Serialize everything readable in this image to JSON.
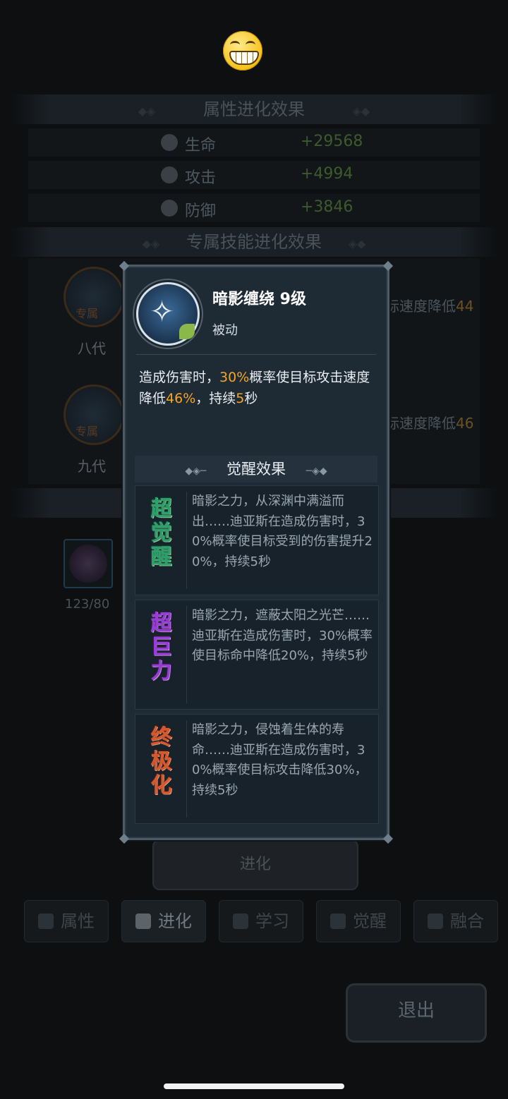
{
  "emoji": "grinning-face-icon",
  "attr_section": {
    "title": "属性进化效果",
    "stats": [
      {
        "label": "生命",
        "value": "+29568",
        "icon": "heart-icon"
      },
      {
        "label": "攻击",
        "value": "+4994",
        "icon": "attack-heart-icon"
      },
      {
        "label": "防御",
        "value": "+3846",
        "icon": "shield-icon"
      }
    ]
  },
  "skill_section": {
    "title": "专属技能进化效果",
    "rows": [
      {
        "tag": "专属",
        "gen": "八代",
        "text_prefix": "标速度降低",
        "value": "44"
      },
      {
        "tag": "专属",
        "gen": "九代",
        "text_prefix": "标速度降低",
        "value": "46"
      }
    ]
  },
  "item": {
    "count": "123/80"
  },
  "evolve_button": "进化",
  "tabs": [
    {
      "label": "属性",
      "icon": "paw-icon"
    },
    {
      "label": "进化",
      "icon": "evolve-arrow-icon"
    },
    {
      "label": "学习",
      "icon": "book-icon"
    },
    {
      "label": "觉醒",
      "icon": "awaken-wolf-icon"
    },
    {
      "label": "融合",
      "icon": "fusion-icon"
    }
  ],
  "exit_button": "退出",
  "popup": {
    "skill_name": "暗影缠绕 9级",
    "skill_type": "被动",
    "desc": {
      "p1": "造成伤害时，",
      "h1": "30%",
      "p2": "概率使目标攻击速度降低",
      "h2": "46%",
      "p3": "，持续",
      "h3": "5",
      "p4": "秒"
    },
    "awaken_title": "觉醒效果",
    "awakens": [
      {
        "badge": "超觉醒",
        "text": "暗影之力，从深渊中满溢而出……迪亚斯在造成伤害时，30%概率使目标受到的伤害提升20%，持续5秒"
      },
      {
        "badge": "超巨力",
        "text": "暗影之力，遮蔽太阳之光芒……迪亚斯在造成伤害时，30%概率使目标命中降低20%，持续5秒"
      },
      {
        "badge": "终极化",
        "text": "暗影之力，侵蚀着生体的寿命……迪亚斯在造成伤害时，30%概率使目标攻击降低30%，持续5秒"
      }
    ]
  },
  "colors": {
    "highlight": "#f5a623",
    "stat_value": "#3d5a2d",
    "popup_bg": "#1e2a34"
  }
}
